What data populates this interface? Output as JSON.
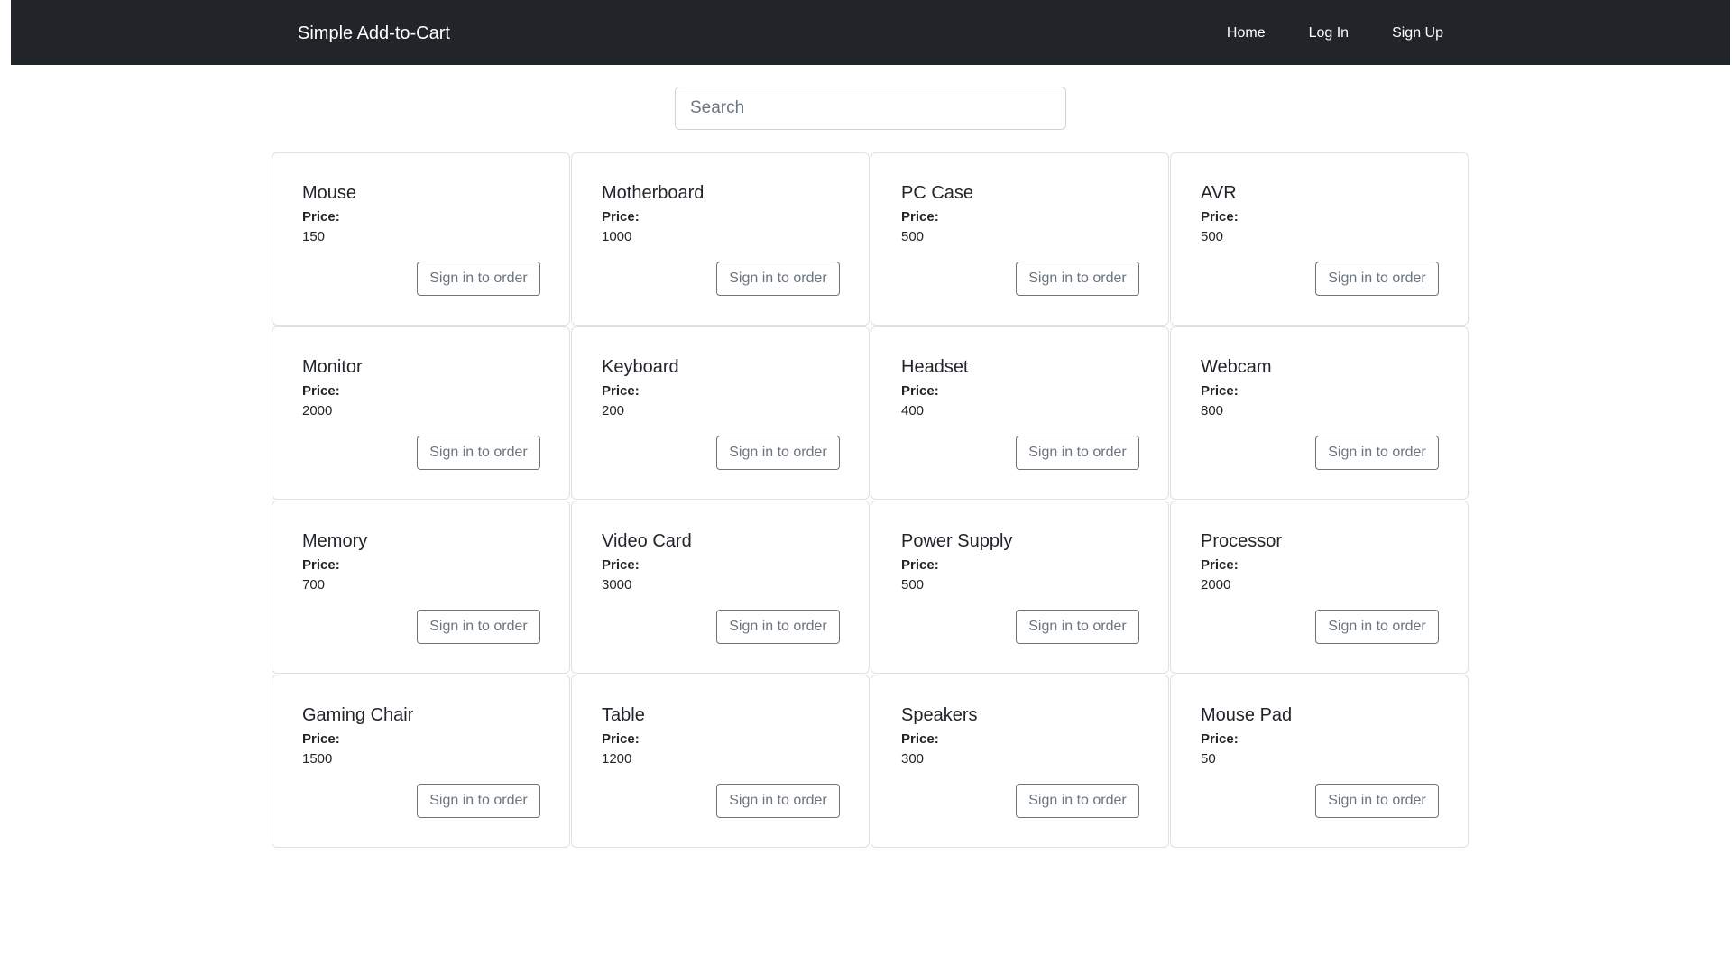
{
  "navbar": {
    "brand": "Simple Add-to-Cart",
    "links": [
      "Home",
      "Log In",
      "Sign Up"
    ]
  },
  "search": {
    "placeholder": "Search",
    "value": ""
  },
  "products": {
    "price_label": "Price:",
    "button_label": "Sign in to order",
    "items": [
      {
        "name": "Mouse",
        "price": "150"
      },
      {
        "name": "Motherboard",
        "price": "1000"
      },
      {
        "name": "PC Case",
        "price": "500"
      },
      {
        "name": "AVR",
        "price": "500"
      },
      {
        "name": "Monitor",
        "price": "2000"
      },
      {
        "name": "Keyboard",
        "price": "200"
      },
      {
        "name": "Headset",
        "price": "400"
      },
      {
        "name": "Webcam",
        "price": "800"
      },
      {
        "name": "Memory",
        "price": "700"
      },
      {
        "name": "Video Card",
        "price": "3000"
      },
      {
        "name": "Power Supply",
        "price": "500"
      },
      {
        "name": "Processor",
        "price": "2000"
      },
      {
        "name": "Gaming Chair",
        "price": "1500"
      },
      {
        "name": "Table",
        "price": "1200"
      },
      {
        "name": "Speakers",
        "price": "300"
      },
      {
        "name": "Mouse Pad",
        "price": "50"
      }
    ]
  },
  "colors": {
    "navbar_bg": "#212529",
    "navbar_text": "#ffffff",
    "button_outline": "#6c757d",
    "card_border": "#dfe1e4"
  }
}
